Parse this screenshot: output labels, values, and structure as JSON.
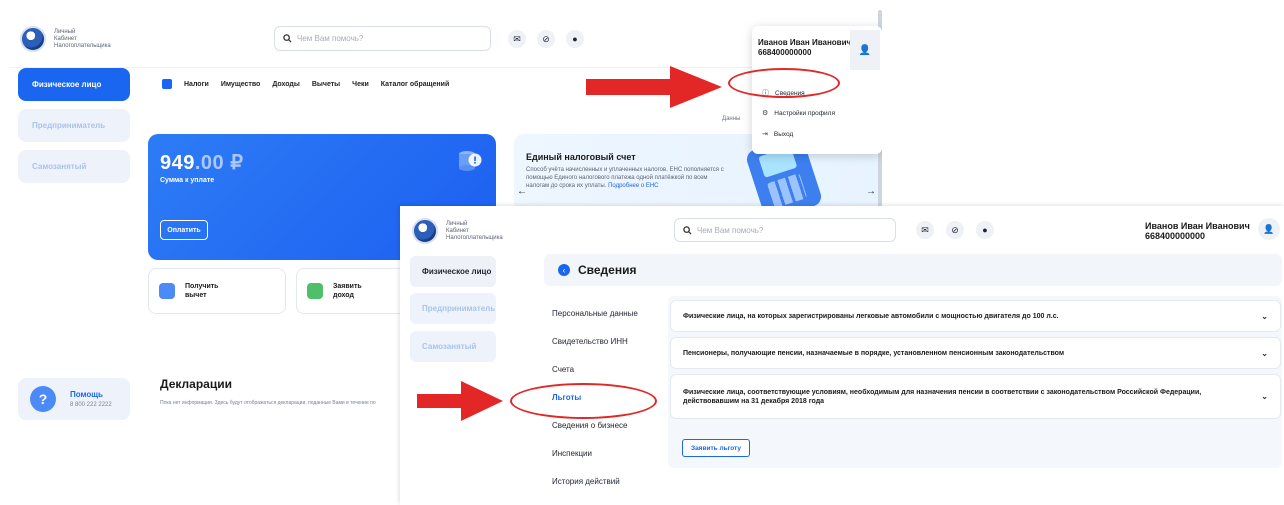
{
  "colors": {
    "accent": "#1a66f0",
    "annotation_red": "#e32626",
    "sidebar_active": "#1a66f0"
  },
  "screen1": {
    "logo_text": [
      "Личный",
      "Кабинет",
      "Налогоплательщика"
    ],
    "search_placeholder": "Чем Вам помочь?",
    "icons": [
      "mail-icon",
      "eye-off-icon",
      "lightbulb-icon"
    ],
    "sidebar": [
      {
        "label": "Физическое лицо",
        "active": true
      },
      {
        "label": "Предприниматель",
        "active": false
      },
      {
        "label": "Самозанятый",
        "active": false
      }
    ],
    "nav": [
      "Налоги",
      "Имущество",
      "Доходы",
      "Вычеты",
      "Чеки",
      "Каталог обращений"
    ],
    "data_link": "Данны",
    "balance": {
      "amount_main": "949",
      "amount_cents": ".00 ₽",
      "label": "Сумма к уплате",
      "pay_button": "Оплатить"
    },
    "ens": {
      "title": "Единый налоговый счет",
      "text": "Способ учёта начисленных и уплаченных налогов. ЕНС пополняется с помощью Единого налогового платежа одной платёжкой по всем налогам до срока их уплаты.",
      "more": "Подробнее о ЕНС"
    },
    "tiles": [
      {
        "label": "Получить вычет"
      },
      {
        "label": "Заявить доход"
      }
    ],
    "declarations": {
      "title": "Декларации",
      "text": "Пока нет информации. Здесь будут отображаться декларации, поданные Вами в течение по"
    },
    "help": {
      "title": "Помощь",
      "phone": "8 800 222 2222"
    },
    "dropdown": {
      "user_name": "Иванов Иван Иванович",
      "inn": "668400000000",
      "items": [
        {
          "label": "Сведения",
          "icon": "info-icon",
          "glyph": "ⓘ"
        },
        {
          "label": "Настройки профиля",
          "icon": "gear-icon",
          "glyph": "⚙"
        },
        {
          "label": "Выход",
          "icon": "logout-icon",
          "glyph": "⇥"
        }
      ]
    }
  },
  "screen2": {
    "logo_text": [
      "Личный",
      "Кабинет",
      "Налогоплательщика"
    ],
    "search_placeholder": "Чем Вам помочь?",
    "user_name": "Иванов Иван Иванович",
    "inn": "668400000000",
    "sidebar": [
      {
        "label": "Физическое лицо",
        "active": true
      },
      {
        "label": "Предприниматель",
        "active": false
      },
      {
        "label": "Самозанятый",
        "active": false
      }
    ],
    "page_title": "Сведения",
    "menu": [
      {
        "label": "Персональные данные",
        "active": false
      },
      {
        "label": "Свидетельство ИНН",
        "active": false
      },
      {
        "label": "Счета",
        "active": false
      },
      {
        "label": "Льготы",
        "active": true
      },
      {
        "label": "Сведения о бизнесе",
        "active": false
      },
      {
        "label": "Инспекции",
        "active": false
      },
      {
        "label": "История действий",
        "active": false
      }
    ],
    "benefits": [
      "Физические лица, на которых зарегистрированы легковые автомобили с мощностью двигателя до 100 л.с.",
      "Пенсионеры, получающие пенсии, назначаемые в порядке, установленном пенсионным законодательством",
      "Физические лица, соответствующие условиям, необходимым для назначения пенсии в соответствии с законодательством Российской Федерации, действовавшим на 31 декабря 2018 года"
    ],
    "claim_button": "Заявить льготу"
  }
}
